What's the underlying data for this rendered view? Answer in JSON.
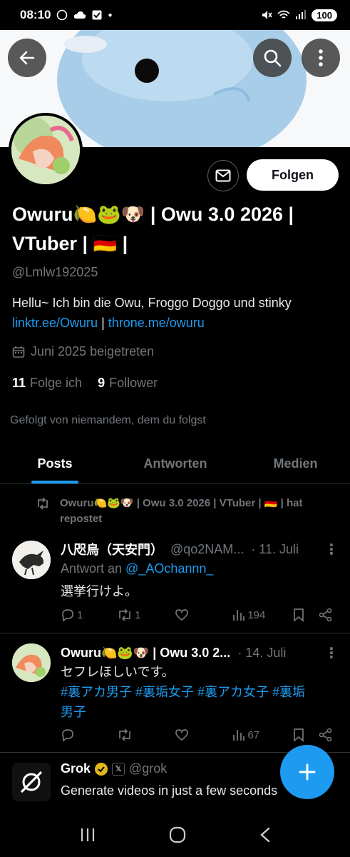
{
  "status_bar": {
    "time": "08:10",
    "battery": "100"
  },
  "profile": {
    "display_name_line1": "Owuru🍋🐸🐶 | Owu 3.0 2026 |",
    "display_name_line2": "VTuber | 🇩🇪 |",
    "handle": "@Lmlw192025",
    "bio_text": "Hellu~ Ich bin die Owu, Froggo Doggo und stinky",
    "bio_link1": "linktr.ee/Owuru",
    "bio_separator": " | ",
    "bio_link2": "throne.me/owuru",
    "joined": "Juni 2025 beigetreten",
    "following_count": "11",
    "following_label": "Folge ich",
    "followers_count": "9",
    "followers_label": "Follower",
    "followed_by": "Gefolgt von niemandem, dem du folgst",
    "follow_button": "Folgen"
  },
  "tabs": [
    {
      "label": "Posts",
      "active": true
    },
    {
      "label": "Antworten",
      "active": false
    },
    {
      "label": "Medien",
      "active": false
    }
  ],
  "posts": [
    {
      "repost_note": "Owuru🍋🐸🐶 | Owu 3.0 2026 | VTuber | 🇩🇪 | hat repostet",
      "name": "八咫烏（天安門）",
      "handle": "@qo2NAM...",
      "date": "· 11. Juli",
      "reply_prefix": "Antwort an ",
      "reply_to": "@_AOchannn_",
      "text": "選挙行けよ。",
      "replies": "1",
      "reposts": "1",
      "likes": "",
      "views": "194"
    },
    {
      "name": "Owuru🍋🐸🐶 | Owu 3.0 2...",
      "date": "· 14. Juli",
      "text": "セフレほしいです。",
      "hashtags_line1": "#裏アカ男子 #裏垢女子 #裏アカ女子 #裏垢",
      "hashtags_line2": "男子",
      "replies": "",
      "reposts": "",
      "likes": "",
      "views": "67"
    },
    {
      "name": "Grok",
      "handle": "@grok",
      "text": "Generate videos in just a few seconds"
    }
  ],
  "colors": {
    "accent": "#1d9bf0",
    "muted": "#71767b",
    "background": "#000000",
    "divider": "#2f3336"
  },
  "icons": [
    "back-arrow-icon",
    "search-icon",
    "more-vertical-icon",
    "mail-icon",
    "calendar-icon",
    "repost-icon",
    "reply-icon",
    "like-icon",
    "views-icon",
    "bookmark-icon",
    "share-icon",
    "plus-icon",
    "verified-badge-icon"
  ]
}
